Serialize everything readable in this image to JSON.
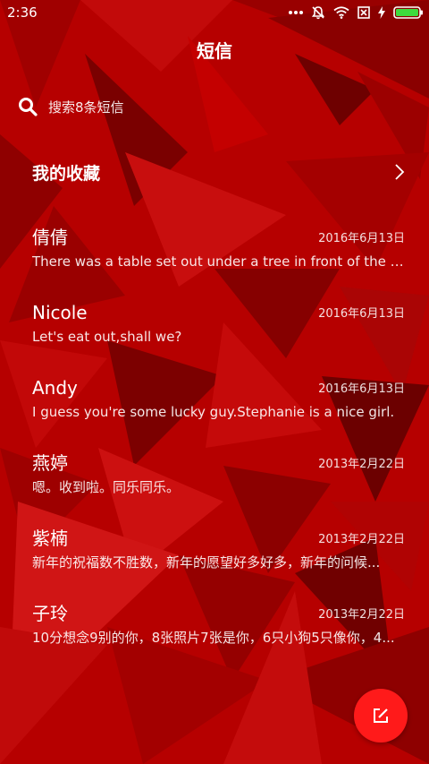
{
  "status_bar": {
    "time": "2:36",
    "icons": [
      "more-dots-icon",
      "mute-bell-icon",
      "wifi-icon",
      "no-sim-icon",
      "charging-icon",
      "battery-icon"
    ],
    "battery_color": "#3ddc3d"
  },
  "header": {
    "title": "短信"
  },
  "search": {
    "placeholder": "搜索8条短信"
  },
  "favorites": {
    "label": "我的收藏"
  },
  "conversations": [
    {
      "name": "倩倩",
      "date": "2016年6月13日",
      "preview": "There was a table set out under a tree in front of the ho..."
    },
    {
      "name": "Nicole",
      "date": "2016年6月13日",
      "preview": "Let's eat out,shall we?"
    },
    {
      "name": "Andy",
      "date": "2016年6月13日",
      "preview": "I guess you're some lucky guy.Stephanie is a nice girl."
    },
    {
      "name": "燕婷",
      "date": "2013年2月22日",
      "preview": "嗯。收到啦。同乐同乐。"
    },
    {
      "name": "紫楠",
      "date": "2013年2月22日",
      "preview": "新年的祝福数不胜数，新年的愿望好多好多，新年的问候..."
    },
    {
      "name": "子玲",
      "date": "2013年2月22日",
      "preview": "10分想念9别的你，8张照片7张是你，6只小狗5只像你，4..."
    }
  ],
  "theme": {
    "background": "#b80000",
    "fab_color": "#ff1a1a"
  }
}
